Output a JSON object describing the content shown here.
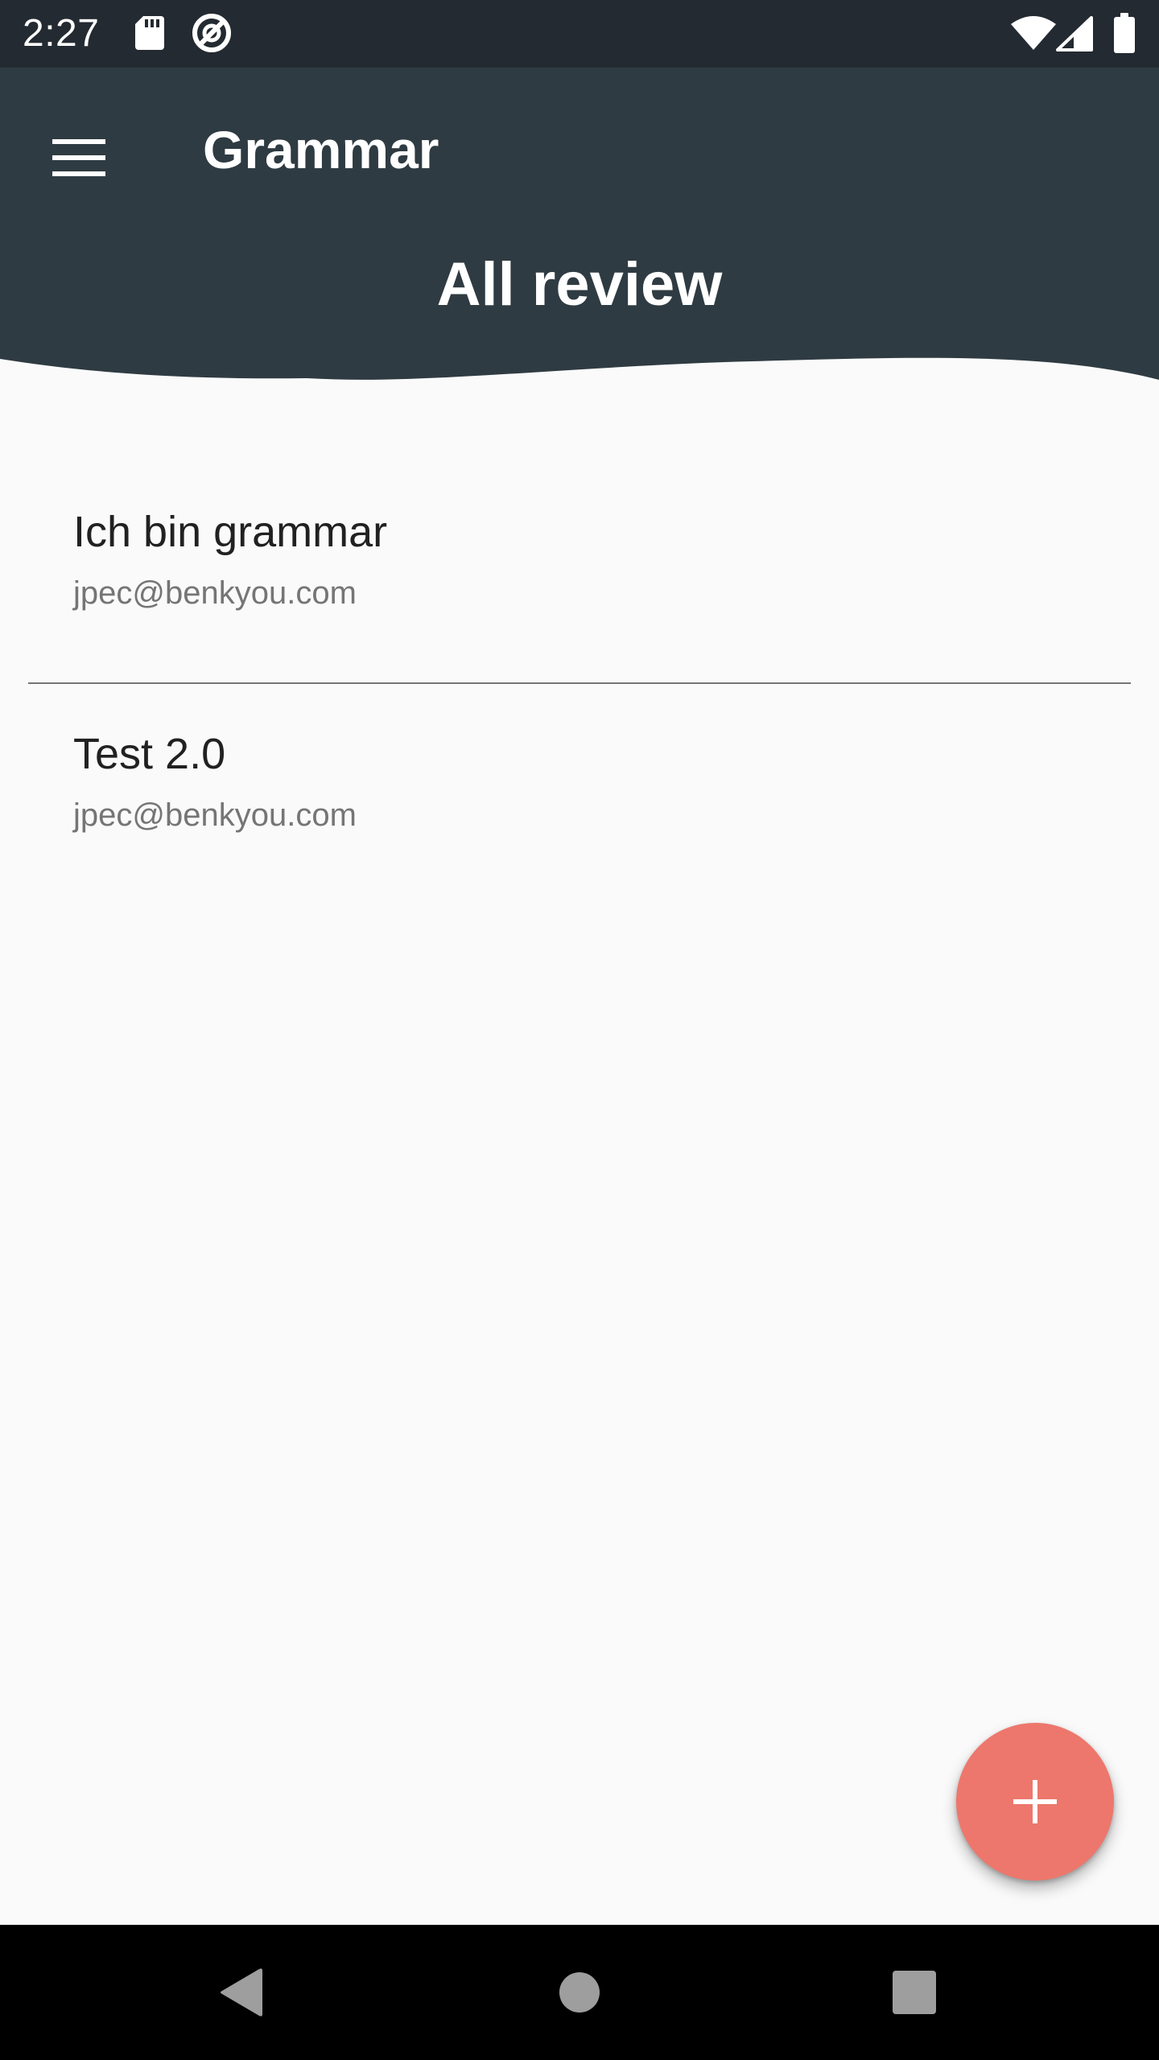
{
  "status_bar": {
    "time": "2:27",
    "left_icons": [
      "sd-card-icon",
      "sync-disabled-icon"
    ],
    "right_icons": [
      "wifi-icon",
      "cell-signal-icon",
      "battery-icon"
    ]
  },
  "app_bar": {
    "menu_icon": "hamburger-menu-icon",
    "title": "Grammar",
    "section_title": "All review",
    "color": "#2f3b42"
  },
  "list": {
    "items": [
      {
        "title": "Ich bin grammar",
        "subtitle": "jpec@benkyou.com"
      },
      {
        "title": "Test 2.0",
        "subtitle": "jpec@benkyou.com"
      }
    ]
  },
  "fab": {
    "icon": "plus-icon",
    "color": "#ed776c"
  },
  "nav_bar": {
    "buttons": [
      "back-icon",
      "home-icon",
      "recents-icon"
    ]
  }
}
